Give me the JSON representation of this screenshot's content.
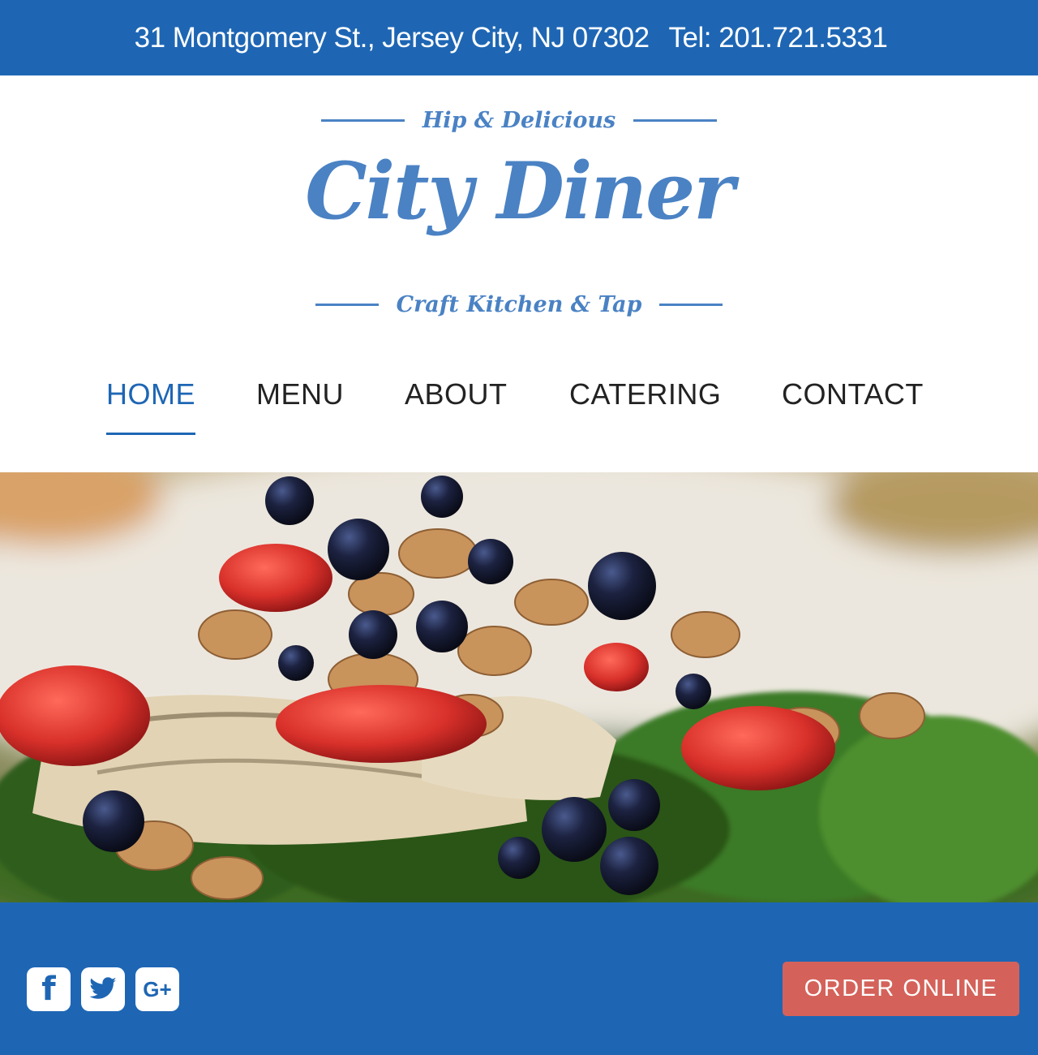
{
  "topbar": {
    "address": "31 Montgomery St., Jersey City, NJ 07302",
    "phone": "Tel: 201.721.5331"
  },
  "logo": {
    "tagline_top": "Hip & Delicious",
    "name": "City Diner",
    "tagline_bottom": "Craft Kitchen & Tap"
  },
  "nav": {
    "items": [
      {
        "label": "HOME",
        "active": true
      },
      {
        "label": "MENU",
        "active": false
      },
      {
        "label": "ABOUT",
        "active": false
      },
      {
        "label": "CATERING",
        "active": false
      },
      {
        "label": "CONTACT",
        "active": false
      }
    ]
  },
  "social": {
    "icons": [
      "facebook-icon",
      "twitter-icon",
      "google-plus-icon"
    ]
  },
  "order": {
    "label": "ORDER ONLINE"
  },
  "colors": {
    "brand_blue": "#1e66b4",
    "logo_blue": "#4a82c4",
    "order_red": "#d4625a"
  }
}
